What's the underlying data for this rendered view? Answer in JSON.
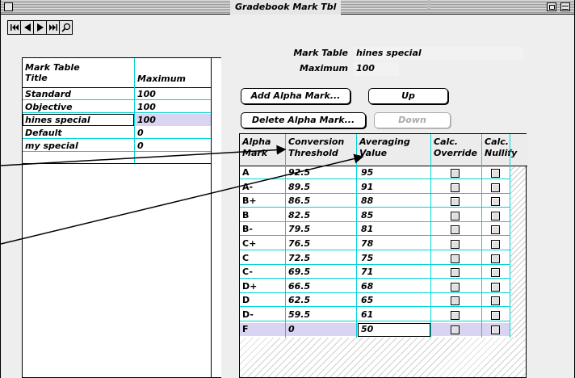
{
  "window": {
    "title": "Gradebook Mark Tbl"
  },
  "nav": {
    "buttons": [
      "first-record",
      "previous-record",
      "next-record",
      "last-record",
      "find"
    ]
  },
  "left_list": {
    "header_title": "Mark Table\nTitle",
    "header_max": "Maximum",
    "rows": [
      {
        "title": "Standard",
        "max": "100"
      },
      {
        "title": "Objective",
        "max": "100"
      },
      {
        "title": "hines special",
        "max": "100"
      },
      {
        "title": "Default",
        "max": "0"
      },
      {
        "title": "my special",
        "max": "0"
      }
    ],
    "selected_index": 2
  },
  "form": {
    "mark_table_label": "Mark Table",
    "mark_table_value": "hines special",
    "maximum_label": "Maximum",
    "maximum_value": "100",
    "add_button": "Add Alpha Mark...",
    "up_button": "Up",
    "delete_button": "Delete Alpha Mark...",
    "down_button": "Down"
  },
  "grid": {
    "headers": {
      "alpha": "Alpha\nMark",
      "threshold": "Conversion\nThreshold",
      "averaging": "Averaging\nValue",
      "override": "Calc.\nOverride",
      "nullify": "Calc.\nNullify"
    },
    "rows": [
      {
        "mark": "A",
        "threshold": "92.5",
        "value": "95"
      },
      {
        "mark": "A-",
        "threshold": "89.5",
        "value": "91"
      },
      {
        "mark": "B+",
        "threshold": "86.5",
        "value": "88"
      },
      {
        "mark": "B",
        "threshold": "82.5",
        "value": "85"
      },
      {
        "mark": "B-",
        "threshold": "79.5",
        "value": "81"
      },
      {
        "mark": "C+",
        "threshold": "76.5",
        "value": "78"
      },
      {
        "mark": "C",
        "threshold": "72.5",
        "value": "75"
      },
      {
        "mark": "C-",
        "threshold": "69.5",
        "value": "71"
      },
      {
        "mark": "D+",
        "threshold": "66.5",
        "value": "68"
      },
      {
        "mark": "D",
        "threshold": "62.5",
        "value": "65"
      },
      {
        "mark": "D-",
        "threshold": "59.5",
        "value": "61"
      },
      {
        "mark": "F",
        "threshold": "0",
        "value": "50"
      }
    ],
    "selected_index": 11
  },
  "colors": {
    "cyan_line": "#00d4d4",
    "selection": "#d8d4f2"
  }
}
